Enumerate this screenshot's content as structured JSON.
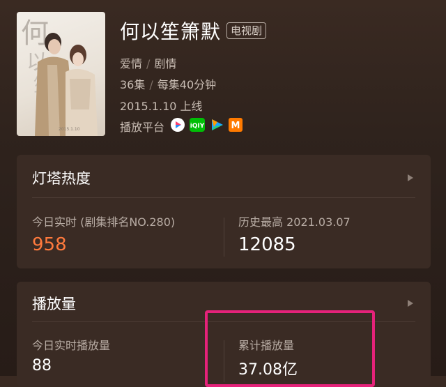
{
  "show": {
    "title": "何以笙箫默",
    "type_tag": "电视剧",
    "genres": [
      "爱情",
      "剧情"
    ],
    "episodes": "36集",
    "episode_length": "每集40分钟",
    "premiere": "2015.1.10 上线",
    "platform_label": "播放平台",
    "platform_icons": [
      "youku-icon",
      "iqiyi-icon",
      "tencent-video-icon",
      "mango-tv-icon"
    ]
  },
  "heat_card": {
    "title": "灯塔热度",
    "today_label": "今日实时 (剧集排名NO.280)",
    "today_value": "958",
    "peak_label": "历史最高 2021.03.07",
    "peak_value": "12085"
  },
  "plays_card": {
    "title": "播放量",
    "today_label": "今日实时播放量",
    "today_value": "88",
    "total_label": "累计播放量",
    "total_value": "37.08亿"
  },
  "colors": {
    "accent_orange": "#ff7a3d",
    "highlight_pink": "#e5227a",
    "card_bg": "#3a2b24"
  }
}
